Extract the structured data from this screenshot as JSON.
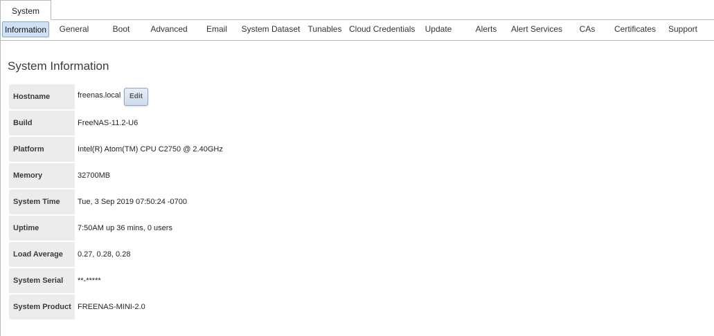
{
  "top_tabs": [
    {
      "label": "System"
    }
  ],
  "sub_tabs": [
    {
      "label": "Information",
      "active": true
    },
    {
      "label": "General"
    },
    {
      "label": "Boot"
    },
    {
      "label": "Advanced"
    },
    {
      "label": "Email"
    },
    {
      "label": "System Dataset"
    },
    {
      "label": "Tunables"
    },
    {
      "label": "Cloud Credentials"
    },
    {
      "label": "Update"
    },
    {
      "label": "Alerts"
    },
    {
      "label": "Alert Services"
    },
    {
      "label": "CAs"
    },
    {
      "label": "Certificates"
    },
    {
      "label": "Support"
    }
  ],
  "section_title": "System Information",
  "info_rows": [
    {
      "label": "Hostname",
      "value": "freenas.local",
      "action_label": "Edit"
    },
    {
      "label": "Build",
      "value": "FreeNAS-11.2-U6"
    },
    {
      "label": "Platform",
      "value": "Intel(R) Atom(TM) CPU C2750 @ 2.40GHz"
    },
    {
      "label": "Memory",
      "value": "32700MB"
    },
    {
      "label": "System Time",
      "value": "Tue, 3 Sep 2019 07:50:24 -0700"
    },
    {
      "label": "Uptime",
      "value": "7:50AM up 36 mins, 0 users"
    },
    {
      "label": "Load Average",
      "value": "0.27, 0.28, 0.28"
    },
    {
      "label": "System Serial",
      "value": "**-*****"
    },
    {
      "label": "System Product",
      "value": "FREENAS-MINI-2.0"
    }
  ],
  "colors": {
    "active_tab_bg": "#cfe2f5",
    "active_tab_border": "#7ea6cf",
    "label_cell_bg": "#ececec",
    "edit_button_border": "#8ea9c6"
  }
}
